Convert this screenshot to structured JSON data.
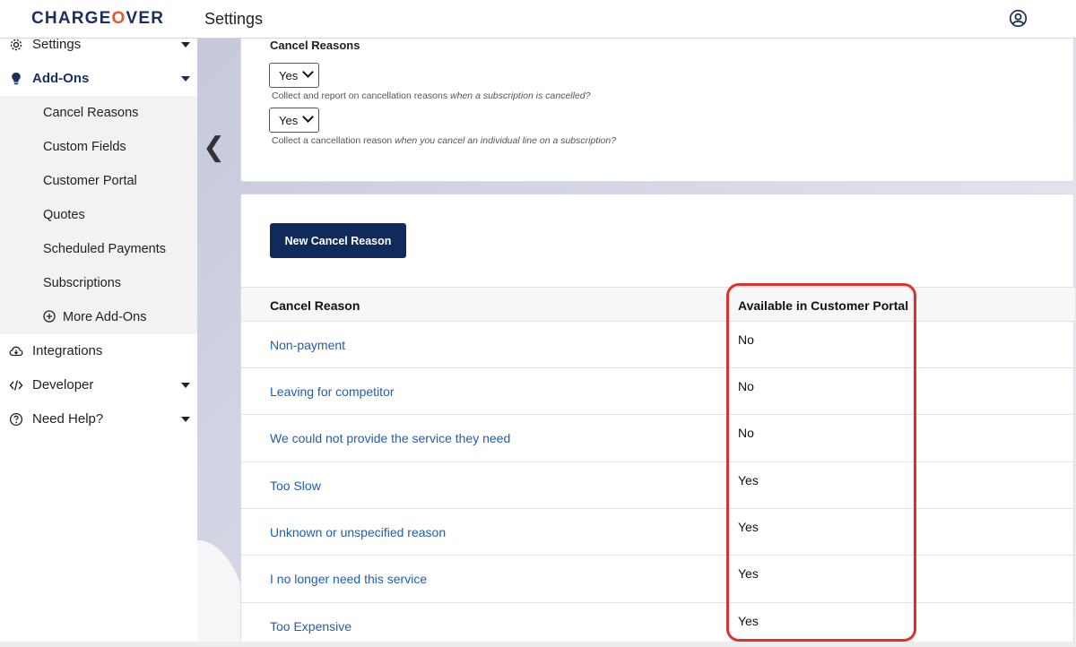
{
  "header": {
    "logo_pre": "CHARGE",
    "logo_o": "O",
    "logo_post": "VER",
    "title": "Settings"
  },
  "sidebar": {
    "settings": "Settings",
    "addons": "Add-Ons",
    "sub_items": [
      "Cancel Reasons",
      "Custom Fields",
      "Customer Portal",
      "Quotes",
      "Scheduled Payments",
      "Subscriptions"
    ],
    "more_addons": "More Add-Ons",
    "integrations": "Integrations",
    "developer": "Developer",
    "need_help": "Need Help?"
  },
  "collapse_glyph": "❮",
  "settings_card": {
    "label": "Cancel Reasons",
    "select1": "Yes",
    "help1_text": "Collect and report on cancellation reasons ",
    "help1_em": "when a subscription is cancelled?",
    "select2": "Yes",
    "help2_text": "Collect a cancellation reason ",
    "help2_em": "when you cancel an individual line on a subscription?"
  },
  "list_card": {
    "new_button": "New Cancel Reason",
    "col_reason": "Cancel Reason",
    "col_available": "Available in Customer Portal",
    "rows": [
      {
        "reason": "Non-payment",
        "available": "No"
      },
      {
        "reason": "Leaving for competitor",
        "available": "No"
      },
      {
        "reason": "We could not provide the service they need",
        "available": "No"
      },
      {
        "reason": "Too Slow",
        "available": "Yes"
      },
      {
        "reason": "Unknown or unspecified reason",
        "available": "Yes"
      },
      {
        "reason": "I no longer need this service",
        "available": "Yes"
      },
      {
        "reason": "Too Expensive",
        "available": "Yes"
      }
    ]
  },
  "colors": {
    "brand_navy": "#1a2f5e",
    "brand_orange": "#e8562a",
    "link_blue": "#1f5fb0",
    "highlight_red": "#e0302c"
  }
}
